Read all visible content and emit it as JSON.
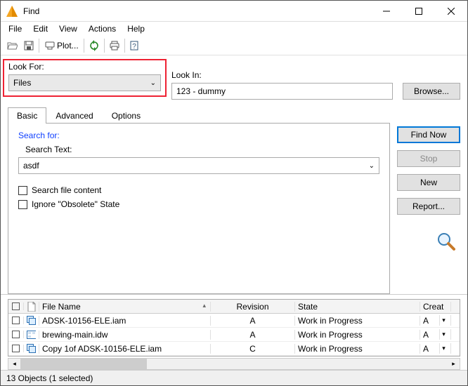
{
  "title": "Find",
  "menus": [
    "File",
    "Edit",
    "View",
    "Actions",
    "Help"
  ],
  "toolbar": {
    "plot_label": "Plot..."
  },
  "look_for": {
    "label": "Look For:",
    "value": "Files"
  },
  "look_in": {
    "label": "Look In:",
    "value": "123 - dummy"
  },
  "browse_label": "Browse...",
  "tabs": {
    "basic": "Basic",
    "advanced": "Advanced",
    "options": "Options"
  },
  "search": {
    "heading": "Search for:",
    "text_label": "Search Text:",
    "text_value": "asdf",
    "file_content": "Search file content",
    "ignore_obsolete": "Ignore \"Obsolete\" State"
  },
  "buttons": {
    "find_now": "Find Now",
    "stop": "Stop",
    "new": "New",
    "report": "Report..."
  },
  "results": {
    "columns": {
      "file_name": "File Name",
      "revision": "Revision",
      "state": "State",
      "created": "Creat"
    },
    "rows": [
      {
        "name": "ADSK-10156-ELE.iam",
        "rev": "A",
        "state": "Work in Progress",
        "cre": "A"
      },
      {
        "name": "brewing-main.idw",
        "rev": "A",
        "state": "Work in Progress",
        "cre": "A"
      },
      {
        "name": "Copy 1of ADSK-10156-ELE.iam",
        "rev": "C",
        "state": "Work in Progress",
        "cre": "A"
      }
    ]
  },
  "status": "13 Objects (1 selected)"
}
